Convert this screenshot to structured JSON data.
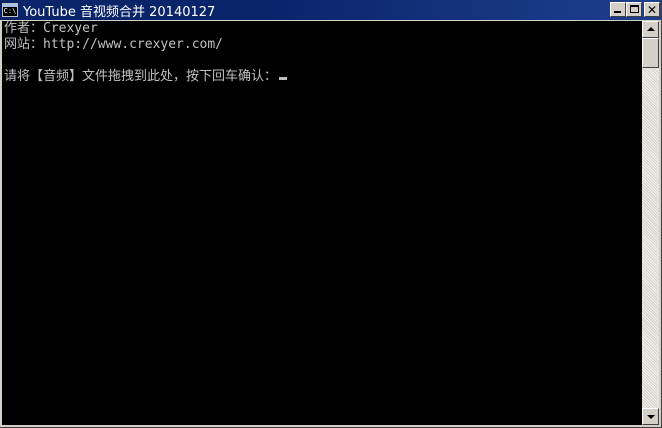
{
  "window": {
    "title": "YouTube 音视频合并 20140127",
    "icon_glyph": "C:\\",
    "titlebar_color": "#0a246a"
  },
  "console": {
    "background": "#000000",
    "foreground": "#c0c0c0",
    "lines": [
      "作者：Crexyer",
      "网站：http://www.crexyer.com/"
    ],
    "prompt": "请将【音频】文件拖拽到此处，按下回车确认："
  },
  "icons": {
    "app": "console-icon",
    "minimize": "minimize-icon",
    "maximize": "maximize-icon",
    "close": "close-icon",
    "scroll_up": "arrow-up-icon",
    "scroll_down": "arrow-down-icon"
  }
}
